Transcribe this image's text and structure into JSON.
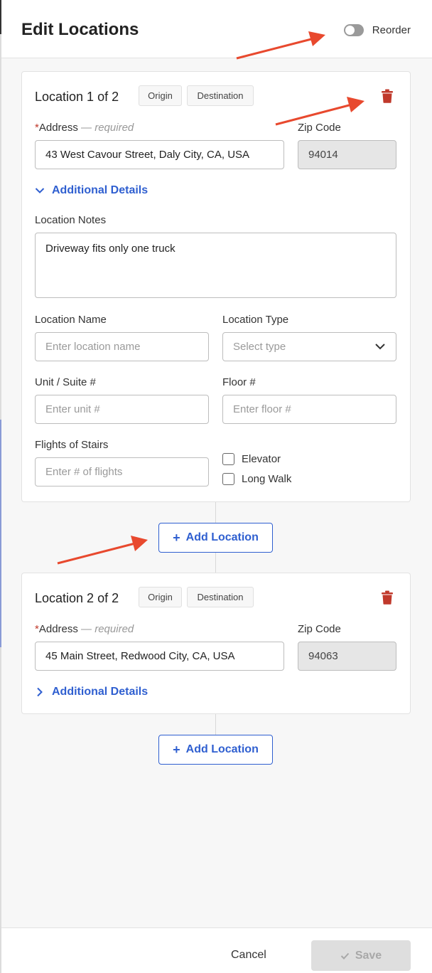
{
  "header": {
    "title": "Edit Locations",
    "reorder_label": "Reorder",
    "reorder_on": false
  },
  "fields": {
    "address_label": "Address",
    "required_text": "— required",
    "zip_label": "Zip Code",
    "additional_details": "Additional Details",
    "notes_label": "Location Notes",
    "name_label": "Location Name",
    "name_placeholder": "Enter location name",
    "type_label": "Location Type",
    "type_placeholder": "Select type",
    "unit_label": "Unit / Suite #",
    "unit_placeholder": "Enter unit #",
    "floor_label": "Floor #",
    "floor_placeholder": "Enter floor #",
    "stairs_label": "Flights of Stairs",
    "stairs_placeholder": "Enter # of flights",
    "elevator_label": "Elevator",
    "longwalk_label": "Long Walk"
  },
  "locations": [
    {
      "title": "Location 1 of 2",
      "tags": [
        "Origin",
        "Destination"
      ],
      "address": "43 West Cavour Street, Daly City, CA, USA",
      "zip": "94014",
      "notes": "Driveway fits only one truck",
      "expanded": true
    },
    {
      "title": "Location 2 of 2",
      "tags": [
        "Origin",
        "Destination"
      ],
      "address": "45 Main Street, Redwood City, CA, USA",
      "zip": "94063",
      "expanded": false
    }
  ],
  "add_location_label": "Add Location",
  "footer": {
    "cancel_label": "Cancel",
    "save_label": "Save"
  },
  "colors": {
    "accent": "#2f5fd0",
    "danger": "#c0392b",
    "annotation_arrow": "#e8492e"
  }
}
